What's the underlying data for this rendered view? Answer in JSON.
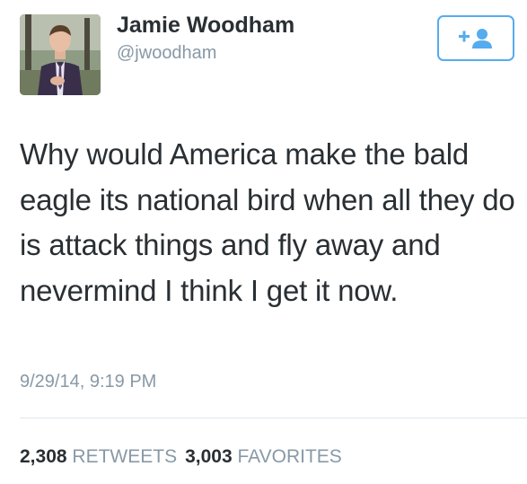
{
  "tweet": {
    "author": {
      "name": "Jamie Woodham",
      "handle": "@jwoodham",
      "avatar_icon": "profile-photo"
    },
    "follow_button": {
      "icon": "follow-person-plus-icon",
      "accent_color": "#55acee"
    },
    "text": "Why would America make the bald eagle its national bird when all they do is attack things and fly away and nevermind I think I get it now.",
    "timestamp": "9/29/14, 9:19 PM",
    "stats": {
      "retweets_count": "2,308",
      "retweets_label": "RETWEETS",
      "favorites_count": "3,003",
      "favorites_label": "FAVORITES"
    }
  }
}
